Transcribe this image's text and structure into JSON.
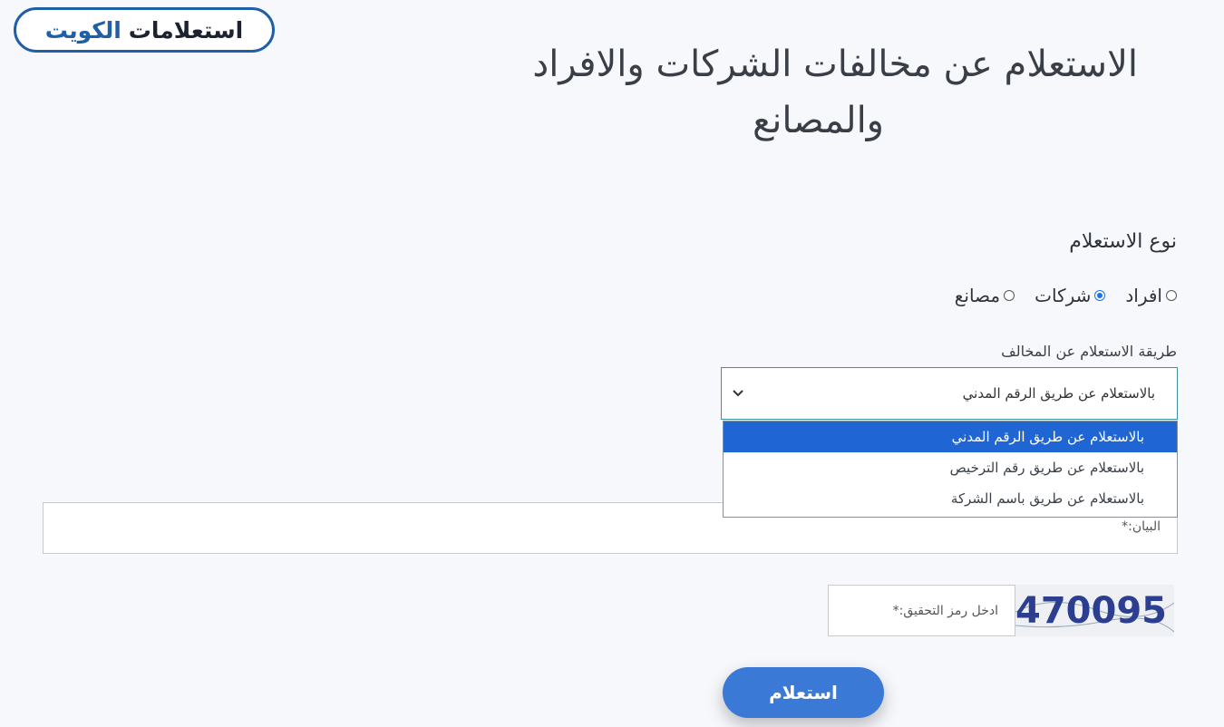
{
  "brand": {
    "part1": "استعلامات",
    "part2": "الكويت",
    "accent": "#1f5fa8"
  },
  "page_title": {
    "line1": "الاستعلام عن مخالفات الشركات والافراد",
    "line2": "والمصانع"
  },
  "inquiry_type": {
    "label": "نوع الاستعلام",
    "options": [
      {
        "label": "افراد",
        "selected": false
      },
      {
        "label": "شركات",
        "selected": true
      },
      {
        "label": "مصانع",
        "selected": false
      }
    ]
  },
  "method": {
    "label": "طريقة الاستعلام عن المخالف",
    "selected": "بالاستعلام عن طريق الرقم المدني",
    "options": [
      "بالاستعلام عن طريق الرقم المدني",
      "بالاستعلام عن طريق رقم الترخيص",
      "بالاستعلام عن طريق باسم الشركة"
    ]
  },
  "data_field": {
    "label": "البيان:*"
  },
  "captcha": {
    "label": "ادخل رمز التحقيق:*",
    "code": "470095"
  },
  "submit_label": "استعلام",
  "colors": {
    "primary_button": "#3a79d6",
    "dropdown_selected": "#1f66d4"
  }
}
